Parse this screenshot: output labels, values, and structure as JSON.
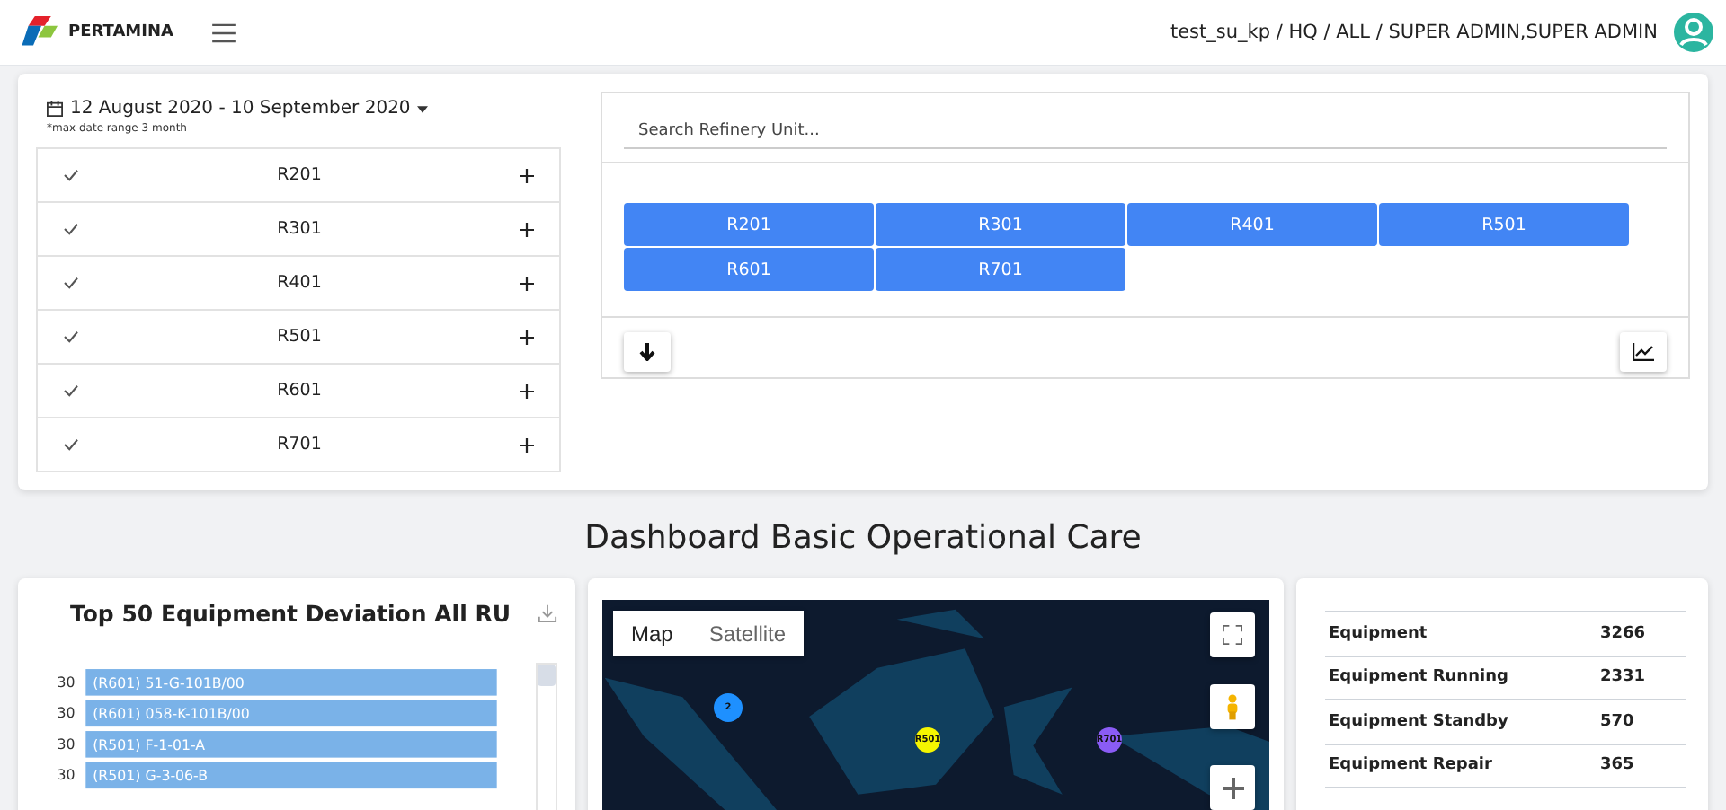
{
  "header": {
    "brand": "PERTAMINA",
    "user": "test_su_kp / HQ / ALL / SUPER ADMIN,SUPER ADMIN"
  },
  "filter": {
    "date_range": "12 August 2020 - 10 September 2020",
    "note": "*max date range 3 month",
    "units": [
      {
        "label": "R201",
        "checked": true
      },
      {
        "label": "R301",
        "checked": true
      },
      {
        "label": "R401",
        "checked": true
      },
      {
        "label": "R501",
        "checked": true
      },
      {
        "label": "R601",
        "checked": true
      },
      {
        "label": "R701",
        "checked": true
      }
    ]
  },
  "refinery": {
    "search": {
      "placeholder": "Search Refinery Unit..."
    },
    "selected_units": [
      "R201",
      "R301",
      "R401",
      "R501",
      "R601",
      "R701"
    ]
  },
  "title": "Dashboard Basic Operational Care",
  "deviation": {
    "title": "Top 50 Equipment Deviation All RU",
    "chart_data": {
      "type": "bar",
      "orientation": "horizontal",
      "categories": [
        "(R601) 51-G-101B/00",
        "(R601) 058-K-101B/00",
        "(R501) F-1-01-A",
        "(R501) G-3-06-B"
      ],
      "values": [
        30,
        30,
        30,
        30
      ],
      "data_labels": true
    }
  },
  "map": {
    "types": [
      {
        "label": "Map",
        "selected": true
      },
      {
        "label": "Satellite",
        "selected": false
      }
    ],
    "markers": [
      {
        "label": "2",
        "color": "#1e90ff"
      },
      {
        "label": "R501",
        "color": "#f5f500"
      },
      {
        "label": "R701",
        "color": "#8a5cf5"
      }
    ]
  },
  "summary": [
    {
      "label": "Equipment",
      "value": "3266"
    },
    {
      "label": "Equipment Running",
      "value": "2331"
    },
    {
      "label": "Equipment Standby",
      "value": "570"
    },
    {
      "label": "Equipment Repair",
      "value": "365"
    }
  ]
}
